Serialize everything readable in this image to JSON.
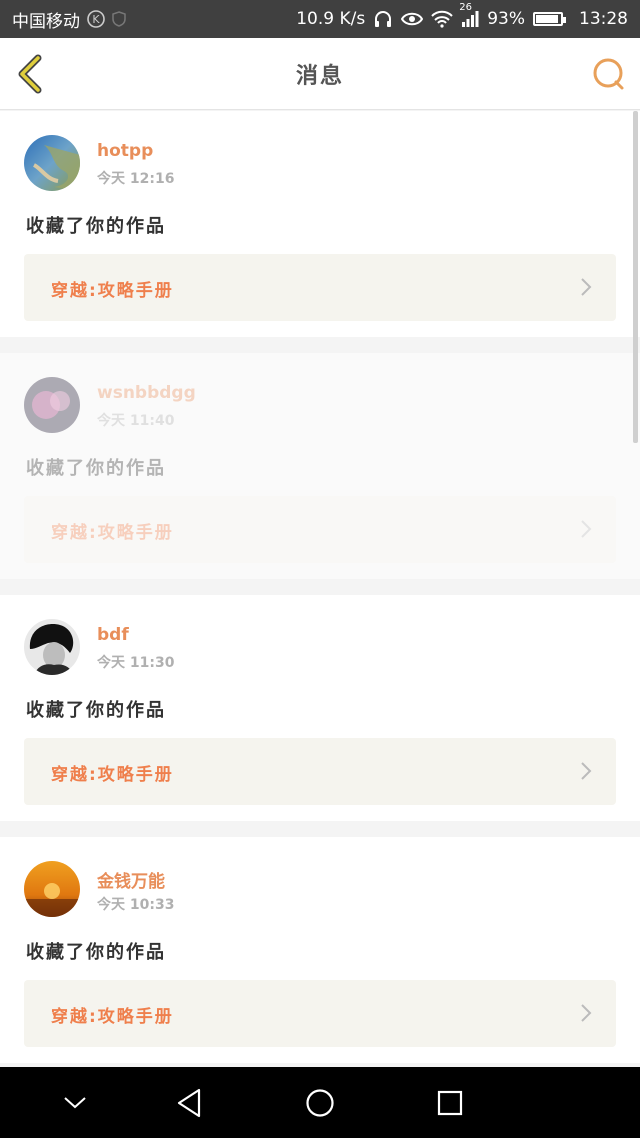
{
  "status_bar": {
    "carrier": "中国移动",
    "speed": "10.9 K/s",
    "network": "26",
    "battery": "93%",
    "battery_level": 0.93,
    "time": "13:28"
  },
  "header": {
    "title": "消息",
    "back_icon": "chevron-left-icon",
    "chat_icon": "chat-bubble-icon",
    "accent_color": "#e8a05a"
  },
  "messages": [
    {
      "username": "hotpp",
      "time": "今天 12:16",
      "action": "收藏了你的作品",
      "work_title": "穿越:攻略手册",
      "dimmed": false
    },
    {
      "username": "wsnbbdgg",
      "time": "今天 11:40",
      "action": "收藏了你的作品",
      "work_title": "穿越:攻略手册",
      "dimmed": true
    },
    {
      "username": "bdf",
      "time": "今天 11:30",
      "action": "收藏了你的作品",
      "work_title": "穿越:攻略手册",
      "dimmed": false
    },
    {
      "username": "金钱万能",
      "time": "今天 10:33",
      "action": "收藏了你的作品",
      "work_title": "穿越:攻略手册",
      "dimmed": false
    }
  ],
  "colors": {
    "username": "#e88e5a",
    "work_title": "#ef7f4c",
    "work_bg": "#f5f4ee"
  }
}
